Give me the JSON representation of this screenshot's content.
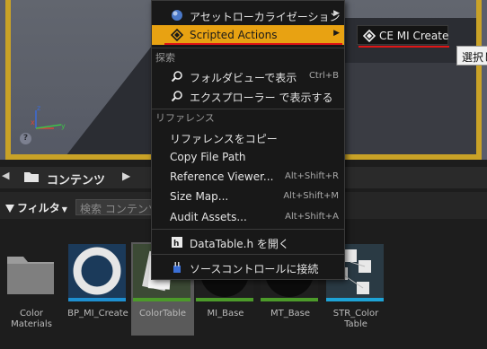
{
  "viewport": {
    "help_icon": "?"
  },
  "content_browser": {
    "title": "コンテンツ",
    "filter_label": "フィルタ",
    "search_placeholder": "検索 コンテンツ",
    "assets": [
      {
        "name": "Color\nMaterials",
        "type": "folder",
        "stripe": ""
      },
      {
        "name": "BP_MI_Create",
        "type": "ring",
        "stripe": "#1e8fd0"
      },
      {
        "name": "ColorTable",
        "type": "datatable",
        "stripe": "#4c9a2a"
      },
      {
        "name": "MI_Base",
        "type": "sphere",
        "stripe": "#4c9a2a"
      },
      {
        "name": "MT_Base",
        "type": "sphere",
        "stripe": "#4c9a2a"
      },
      {
        "name": "STR_Color\nTable",
        "type": "struct",
        "stripe": "#1ea3d6"
      }
    ]
  },
  "menu": {
    "items": [
      {
        "label": "アセットローカライゼーション",
        "icon": "globe-icon",
        "arrow": "▶"
      },
      {
        "label": "Scripted Actions",
        "icon": "diamond-icon",
        "arrow": "▶"
      },
      {
        "section": "探索"
      },
      {
        "label": "フォルダビューで表示",
        "icon": "magnifier-icon",
        "shortcut": "Ctrl+B"
      },
      {
        "label": "エクスプローラー で表示する",
        "icon": "magnifier-icon"
      },
      {
        "section": "リファレンス"
      },
      {
        "label": "リファレンスをコピー"
      },
      {
        "label": "Copy File Path"
      },
      {
        "label": "Reference Viewer...",
        "shortcut": "Alt+Shift+R"
      },
      {
        "label": "Size Map...",
        "shortcut": "Alt+Shift+M"
      },
      {
        "label": "Audit Assets...",
        "shortcut": "Alt+Shift+A"
      },
      {
        "label": "DataTable.h を開く",
        "icon": "header-file-icon"
      },
      {
        "label": "ソースコントロールに接続",
        "icon": "source-control-icon"
      }
    ]
  },
  "submenu": {
    "label": "CE MI Create",
    "icon": "diamond-icon"
  },
  "tooltip": {
    "text": "選択し"
  },
  "colors": {
    "highlight": "#e8a212",
    "underline": "#e01515",
    "viewport_frame": "#c9a227"
  }
}
